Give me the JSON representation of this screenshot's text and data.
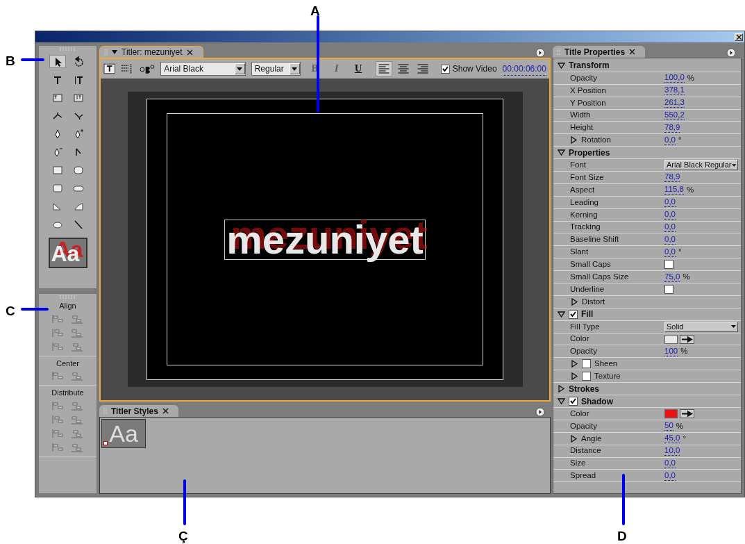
{
  "annotations": [
    {
      "label": "A"
    },
    {
      "label": "B"
    },
    {
      "label": "C"
    },
    {
      "label": "Ç"
    },
    {
      "label": "D"
    }
  ],
  "tools": [
    {
      "selected": true
    },
    {
      "selected": false
    },
    {
      "selected": false
    },
    {
      "selected": false
    },
    {
      "selected": false
    },
    {
      "selected": false
    },
    {
      "selected": false
    },
    {
      "selected": false
    },
    {
      "selected": false
    },
    {
      "selected": false
    },
    {
      "selected": false
    },
    {
      "selected": false
    },
    {
      "selected": false
    },
    {
      "selected": false
    },
    {
      "selected": false
    },
    {
      "selected": false
    },
    {
      "selected": false
    },
    {
      "selected": false
    },
    {
      "selected": false
    },
    {
      "selected": false
    }
  ],
  "tool_preview": {
    "text": "Aa"
  },
  "align_panel": {
    "sections": [
      {
        "title": "Align"
      },
      {
        "title": "Center"
      },
      {
        "title": "Distribute"
      }
    ]
  },
  "titler": {
    "tab": "Titler: mezuniyet",
    "font": "Arial Black",
    "style": "Regular",
    "format_buttons": [
      {
        "label": "B",
        "disabled": true
      },
      {
        "label": "I",
        "disabled": true
      },
      {
        "label": "U",
        "disabled": false
      }
    ],
    "text_align": [
      {
        "selected": true
      },
      {
        "selected": false
      },
      {
        "selected": false
      }
    ],
    "show_video": {
      "label": "Show Video",
      "checked": true
    },
    "timecode": "00:00:06:00",
    "canvas_text": "mezuniyet"
  },
  "styles": {
    "title": "Titler Styles",
    "swatches": [
      {
        "text": "Aa"
      }
    ]
  },
  "properties": {
    "title": "Title Properties",
    "rows": [
      {
        "kind": "section",
        "label": "Transform",
        "expanded": true
      },
      {
        "kind": "value",
        "label": "Opacity",
        "value": "100,0",
        "unit": "%"
      },
      {
        "kind": "value",
        "label": "X Position",
        "value": "378,1"
      },
      {
        "kind": "value",
        "label": "Y Position",
        "value": "261,3"
      },
      {
        "kind": "value",
        "label": "Width",
        "value": "550,2"
      },
      {
        "kind": "value",
        "label": "Height",
        "value": "78,9"
      },
      {
        "kind": "value",
        "label": "Rotation",
        "value": "0,0",
        "unit": "°",
        "expanded": false
      },
      {
        "kind": "section",
        "label": "Properties",
        "expanded": true
      },
      {
        "kind": "dropdown",
        "label": "Font",
        "value": "Arial Black Regular"
      },
      {
        "kind": "value",
        "label": "Font Size",
        "value": "78,9"
      },
      {
        "kind": "value",
        "label": "Aspect",
        "value": "115,8",
        "unit": "%"
      },
      {
        "kind": "value",
        "label": "Leading",
        "value": "0,0"
      },
      {
        "kind": "value",
        "label": "Kerning",
        "value": "0,0"
      },
      {
        "kind": "value",
        "label": "Tracking",
        "value": "0,0"
      },
      {
        "kind": "value",
        "label": "Baseline Shift",
        "value": "0,0"
      },
      {
        "kind": "value",
        "label": "Slant",
        "value": "0,0",
        "unit": "°"
      },
      {
        "kind": "checkbox",
        "label": "Small Caps",
        "checked": false
      },
      {
        "kind": "value",
        "label": "Small Caps Size",
        "value": "75,0",
        "unit": "%"
      },
      {
        "kind": "checkbox",
        "label": "Underline",
        "checked": false
      },
      {
        "kind": "group",
        "label": "Distort",
        "expanded": false
      },
      {
        "kind": "section",
        "label": "Fill",
        "expanded": true,
        "checked": true
      },
      {
        "kind": "dropdown",
        "label": "Fill Type",
        "value": "Solid"
      },
      {
        "kind": "color",
        "label": "Color",
        "color": "#e8e8e8"
      },
      {
        "kind": "value",
        "label": "Opacity",
        "value": "100",
        "unit": "%"
      },
      {
        "kind": "group",
        "label": "Sheen",
        "expanded": false,
        "checked": false
      },
      {
        "kind": "group",
        "label": "Texture",
        "expanded": false,
        "checked": false
      },
      {
        "kind": "section",
        "label": "Strokes",
        "expanded": false
      },
      {
        "kind": "section",
        "label": "Shadow",
        "expanded": true,
        "checked": true
      },
      {
        "kind": "color",
        "label": "Color",
        "color": "#ee1111"
      },
      {
        "kind": "value",
        "label": "Opacity",
        "value": "50",
        "unit": "%"
      },
      {
        "kind": "value",
        "label": "Angle",
        "value": "45,0",
        "unit": "°",
        "expanded": false
      },
      {
        "kind": "value",
        "label": "Distance",
        "value": "10,0"
      },
      {
        "kind": "value",
        "label": "Size",
        "value": "0,0"
      },
      {
        "kind": "value",
        "label": "Spread",
        "value": "0,0"
      }
    ]
  }
}
